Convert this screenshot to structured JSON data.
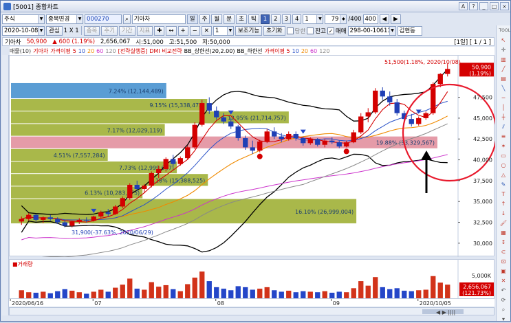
{
  "window": {
    "title": "[5001] 종합차트",
    "buttons": [
      "A",
      "?",
      "_",
      "□",
      "×"
    ]
  },
  "toolbar1": {
    "market": "주식",
    "mode": "종목변경",
    "code": "000270",
    "name": "기아차",
    "period_buttons": [
      "일",
      "주",
      "월",
      "분",
      "초",
      "틱"
    ],
    "number_buttons": [
      "1",
      "2",
      "3",
      "4"
    ],
    "number_value": "1",
    "count_value": "79",
    "count_max": "/400",
    "count_input": "400",
    "arrow_left": "◀",
    "arrow_right": "▶"
  },
  "toolbar2": {
    "date": "2020-10-08",
    "interest": "관심",
    "ratio": "1 X 1",
    "btn_a": "종목",
    "btn_b": "주기",
    "btn_c": "기간",
    "btn_d": "지표",
    "zoom": "1",
    "basic_view": "보조기능",
    "init": "초기화",
    "chk_a": "당한",
    "chk_b": "잔고",
    "chk_c": "매매",
    "account": "298-00-106113",
    "owner": "김현동"
  },
  "info": {
    "name": "기아차",
    "price": "50,900",
    "change": "▲ 600 (1.19%)",
    "volume": "2,656,067",
    "open": "시:51,000",
    "high": "고:51,500",
    "low": "저:50,000",
    "pager": "[1일] [ 1 / 1 ]"
  },
  "legend": {
    "items": [
      {
        "text": "매물(10)",
        "color": "#3a3a3a"
      },
      {
        "text": "기아차",
        "color": "#d40000"
      },
      {
        "text": "가격이평",
        "color": "#d40000"
      },
      {
        "text": "5",
        "color": "#d40000"
      },
      {
        "text": "10",
        "color": "#2a52c8"
      },
      {
        "text": "20",
        "color": "#f08a00"
      },
      {
        "text": "60",
        "color": "#cc33cc"
      },
      {
        "text": "120",
        "color": "#888888"
      },
      {
        "text": "[전략실행중] DMI 비교전략",
        "color": "#d40000"
      },
      {
        "text": "BB_상한선(20,2.00)",
        "color": "#000000"
      },
      {
        "text": "BB_하한선",
        "color": "#000000"
      },
      {
        "text": "가격이평 5",
        "color": "#d40000"
      },
      {
        "text": "10",
        "color": "#2a52c8"
      },
      {
        "text": "20",
        "color": "#f08a00"
      },
      {
        "text": "60",
        "color": "#cc33cc"
      },
      {
        "text": "120",
        "color": "#888888"
      }
    ]
  },
  "price_axis": {
    "labels": [
      "50,900",
      "(1.19%)",
      "47,500",
      "45,000",
      "42,500",
      "40,000",
      "37,500",
      "35,000",
      "32,500",
      "30,000"
    ],
    "current": "50,900",
    "current_pct": "(1.19%)"
  },
  "volume_profile": {
    "bars": [
      {
        "label": "7.24% (12,144,489)",
        "price_low": 47300,
        "price_high": 49200,
        "pct": 7.24,
        "color": "#3d8ccc"
      },
      {
        "label": "9.15% (15,338,472)",
        "price_low": 45800,
        "price_high": 47300,
        "pct": 9.15,
        "color": "#9aab2a"
      },
      {
        "label": "12.95% (21,714,757)",
        "price_low": 44300,
        "price_high": 45800,
        "pct": 12.95,
        "color": "#9aab2a"
      },
      {
        "label": "7.17% (12,029,119)",
        "price_low": 42800,
        "price_high": 44300,
        "pct": 7.17,
        "color": "#9aab2a"
      },
      {
        "label": "19.88% (33,329,567)",
        "price_low": 41300,
        "price_high": 42800,
        "pct": 19.88,
        "color": "#e08a99"
      },
      {
        "label": "4.51% (7,557,284)",
        "price_low": 39800,
        "price_high": 41300,
        "pct": 4.51,
        "color": "#9aab2a"
      },
      {
        "label": "7.73% (12,999,647)",
        "price_low": 38300,
        "price_high": 39800,
        "pct": 7.73,
        "color": "#9aab2a"
      },
      {
        "label": "9.18% (15,388,525)",
        "price_low": 36800,
        "price_high": 38300,
        "pct": 9.18,
        "color": "#9aab2a"
      },
      {
        "label": "6.13% (10,283,075)",
        "price_low": 35300,
        "price_high": 36800,
        "pct": 6.13,
        "color": "#9aab2a"
      },
      {
        "label": "16.10% (26,999,004)",
        "price_low": 32300,
        "price_high": 35300,
        "pct": 16.1,
        "color": "#9aab2a"
      }
    ]
  },
  "annotations": {
    "high_label": "51,500(1.18%, 2020/10/08)",
    "low_label": "31,900(-37.63%, 2020/06/29)"
  },
  "volume": {
    "title": "거래량",
    "axis": "5,000K",
    "value": "2,656,067",
    "value_pct": "(121.73%)"
  },
  "x_labels": [
    "2020/06/16",
    "07",
    "08",
    "09",
    "2020/10/05"
  ],
  "chart_data": {
    "type": "candlestick",
    "title": "",
    "ylim": [
      29000,
      52000
    ],
    "candles": [
      [
        32600,
        33200,
        32200,
        32900
      ],
      [
        32900,
        33600,
        32700,
        33400
      ],
      [
        33400,
        33500,
        32600,
        32800
      ],
      [
        32800,
        33200,
        32400,
        33100
      ],
      [
        33100,
        33400,
        32700,
        32900
      ],
      [
        32900,
        33100,
        32300,
        32500
      ],
      [
        32500,
        32800,
        31900,
        32100
      ],
      [
        32100,
        32700,
        31900,
        32600
      ],
      [
        32600,
        33000,
        32300,
        32800
      ],
      [
        32800,
        33100,
        32500,
        32700
      ],
      [
        32700,
        33300,
        32600,
        33200
      ],
      [
        33200,
        33900,
        33000,
        33700
      ],
      [
        33700,
        34100,
        33200,
        33500
      ],
      [
        33500,
        34600,
        33400,
        34400
      ],
      [
        34400,
        35600,
        34200,
        35400
      ],
      [
        35400,
        37200,
        35200,
        37000
      ],
      [
        37000,
        37500,
        36200,
        36500
      ],
      [
        36500,
        37100,
        36000,
        36900
      ],
      [
        36900,
        38600,
        36700,
        38400
      ],
      [
        38400,
        39300,
        37800,
        38900
      ],
      [
        38900,
        40300,
        38600,
        40100
      ],
      [
        40100,
        40600,
        39200,
        39500
      ],
      [
        39500,
        40400,
        39300,
        40200
      ],
      [
        40200,
        41700,
        40000,
        41500
      ],
      [
        41500,
        44500,
        41300,
        44200
      ],
      [
        44200,
        47200,
        44000,
        46800
      ],
      [
        46800,
        47500,
        45500,
        45900
      ],
      [
        45900,
        46400,
        44800,
        45100
      ],
      [
        45100,
        45600,
        44300,
        44600
      ],
      [
        44600,
        45100,
        43700,
        44000
      ],
      [
        44000,
        44200,
        42300,
        42600
      ],
      [
        42600,
        42900,
        41200,
        41500
      ],
      [
        41500,
        42300,
        40700,
        41100
      ],
      [
        41100,
        42400,
        40900,
        42200
      ],
      [
        42200,
        43700,
        42000,
        43400
      ],
      [
        43400,
        43900,
        42500,
        42800
      ],
      [
        42800,
        43200,
        42100,
        42500
      ],
      [
        42500,
        43400,
        42300,
        43100
      ],
      [
        43100,
        43400,
        42300,
        42600
      ],
      [
        42600,
        42800,
        41700,
        42000
      ],
      [
        42000,
        42700,
        41800,
        42500
      ],
      [
        42500,
        42600,
        41600,
        41800
      ],
      [
        41800,
        42500,
        41500,
        42300
      ],
      [
        42300,
        42700,
        41900,
        42100
      ],
      [
        42100,
        42300,
        41400,
        41600
      ],
      [
        41600,
        42300,
        41500,
        42100
      ],
      [
        42100,
        43600,
        42000,
        43300
      ],
      [
        43300,
        45600,
        43100,
        45200
      ],
      [
        45200,
        46200,
        44500,
        45700
      ],
      [
        45700,
        48600,
        45500,
        48300
      ],
      [
        48300,
        48700,
        47200,
        47600
      ],
      [
        47600,
        48200,
        46500,
        46900
      ],
      [
        46900,
        47300,
        45300,
        45600
      ],
      [
        45600,
        45900,
        44600,
        44900
      ],
      [
        44900,
        45500,
        44000,
        44300
      ],
      [
        44300,
        45200,
        44100,
        45000
      ],
      [
        45000,
        45800,
        44800,
        45600
      ],
      [
        45600,
        49300,
        45400,
        49100
      ],
      [
        49100,
        50400,
        48700,
        50300
      ],
      [
        50300,
        51500,
        50000,
        50900
      ]
    ],
    "volumes": [
      1600,
      1200,
      1100,
      1300,
      1000,
      1400,
      1800,
      1500,
      1200,
      900,
      1300,
      1700,
      1300,
      2100,
      2700,
      3900,
      1900,
      1700,
      3200,
      2300,
      2600,
      1800,
      1400,
      2800,
      4100,
      5300,
      3400,
      2200,
      1900,
      1600,
      2400,
      2200,
      1700,
      1900,
      2200,
      1600,
      1300,
      1500,
      1200,
      1400,
      1300,
      1200,
      1400,
      1100,
      1300,
      1200,
      2000,
      3400,
      2500,
      4200,
      2200,
      1800,
      2000,
      1500,
      1400,
      1600,
      1700,
      4400,
      3100,
      2700
    ]
  }
}
